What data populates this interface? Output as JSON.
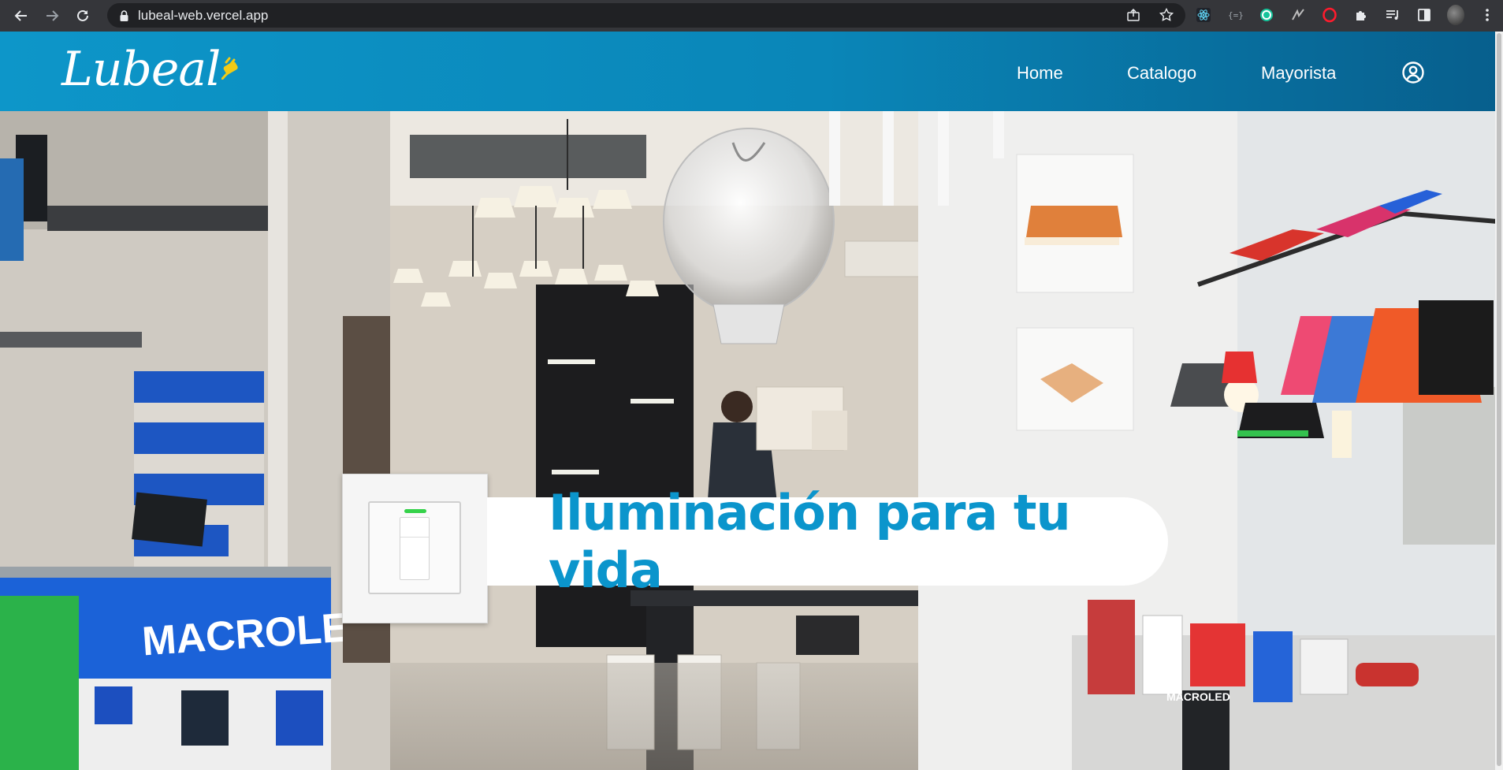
{
  "browser": {
    "url": "lubeal-web.vercel.app"
  },
  "header": {
    "logo": "Lubeal",
    "nav": [
      {
        "label": "Home"
      },
      {
        "label": "Catalogo"
      },
      {
        "label": "Mayorista"
      }
    ]
  },
  "hero": {
    "headline": "Iluminación para tu vida",
    "photo_signs": {
      "counter_brand": "MACROLED",
      "box_brand": "MACROLED"
    }
  },
  "colors": {
    "header_blue": "#0d96c9",
    "headline_blue": "#0b95cc",
    "switch_led": "#35d24a"
  }
}
